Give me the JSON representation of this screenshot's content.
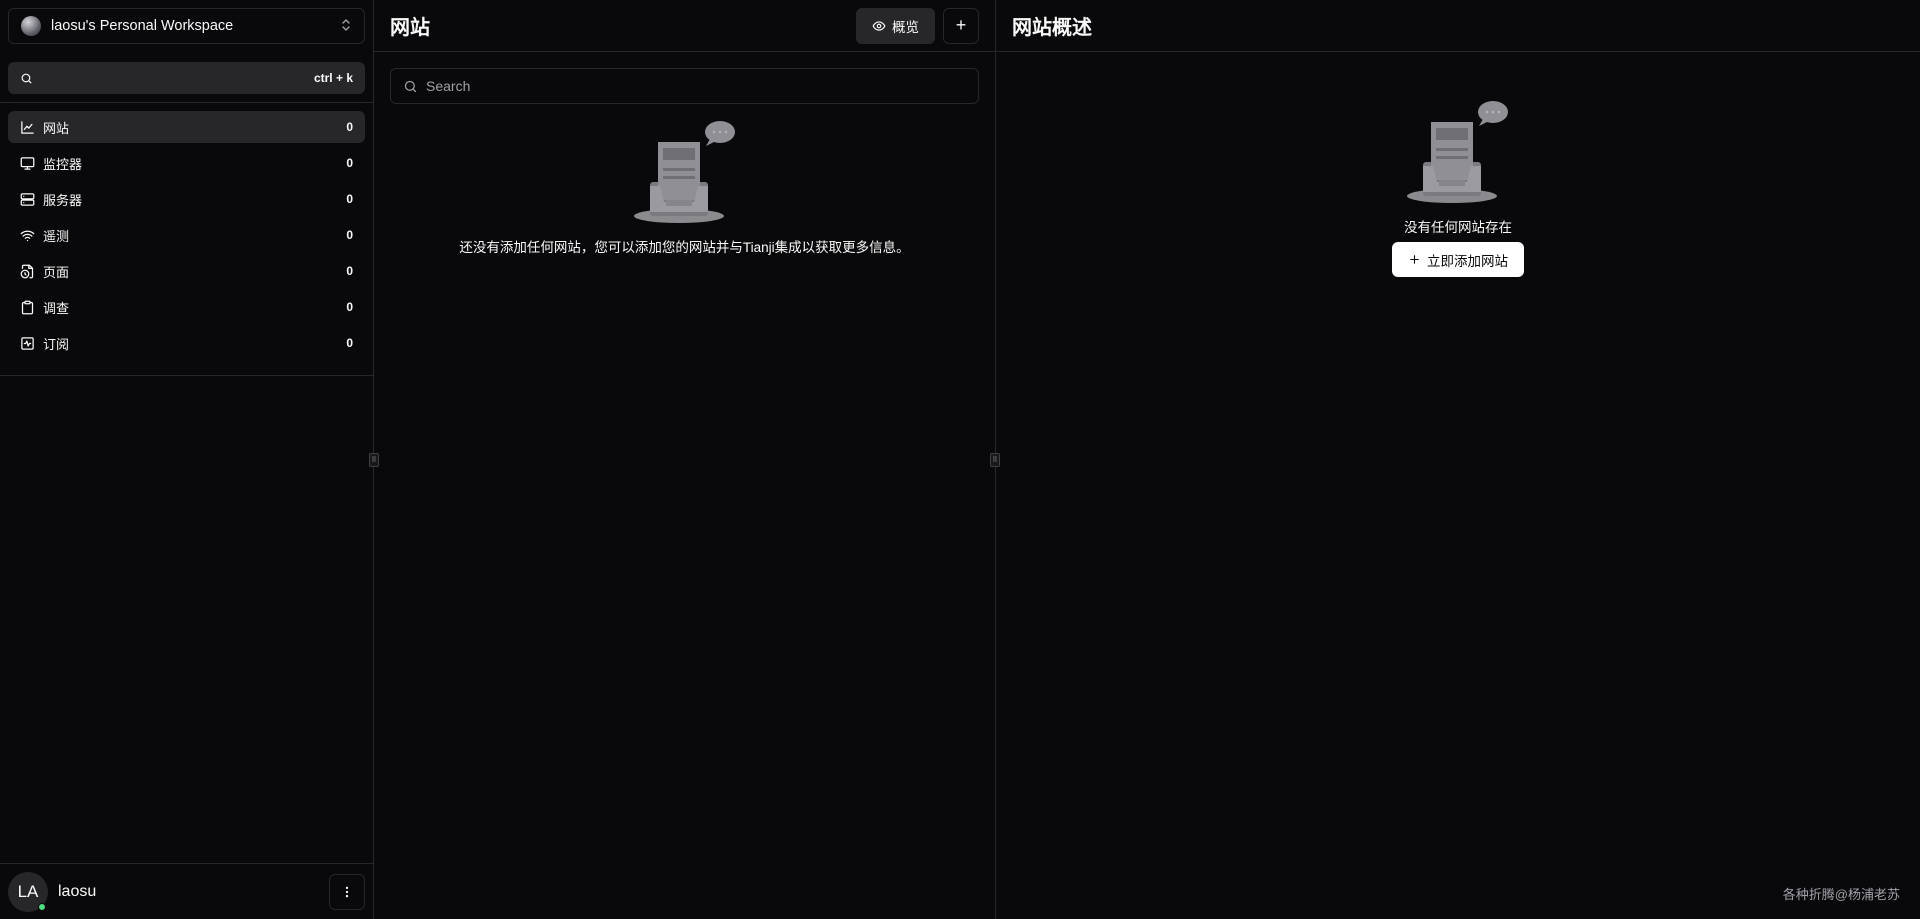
{
  "workspace": {
    "name": "laosu's Personal Workspace"
  },
  "search": {
    "shortcut": "ctrl + k"
  },
  "nav": {
    "items": [
      {
        "label": "网站",
        "count": "0",
        "icon": "chart-icon"
      },
      {
        "label": "监控器",
        "count": "0",
        "icon": "monitor-icon"
      },
      {
        "label": "服务器",
        "count": "0",
        "icon": "server-icon"
      },
      {
        "label": "遥测",
        "count": "0",
        "icon": "wifi-icon"
      },
      {
        "label": "页面",
        "count": "0",
        "icon": "file-clock-icon"
      },
      {
        "label": "调查",
        "count": "0",
        "icon": "clipboard-icon"
      },
      {
        "label": "订阅",
        "count": "0",
        "icon": "activity-icon"
      }
    ]
  },
  "user": {
    "initials": "LA",
    "name": "laosu"
  },
  "websites": {
    "title": "网站",
    "overview_label": "概览",
    "add_label": "+",
    "search_placeholder": "Search",
    "empty_text": "还没有添加任何网站，您可以添加您的网站并与Tianji集成以获取更多信息。"
  },
  "overview": {
    "title": "网站概述",
    "empty_text": "没有任何网站存在",
    "add_button_label": "立即添加网站"
  },
  "watermark": "各种折腾@杨浦老苏",
  "colors": {
    "background": "#09090b",
    "border": "#27272a",
    "accent_online": "#4ade80"
  }
}
